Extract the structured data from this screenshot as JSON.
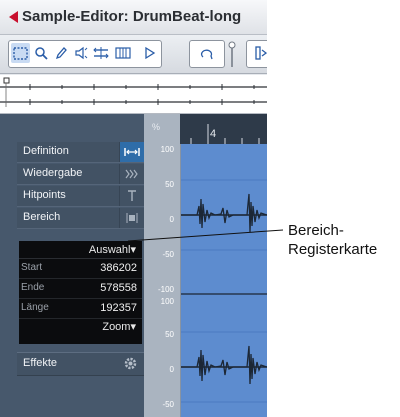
{
  "window": {
    "title": "Sample-Editor: DrumBeat-long"
  },
  "toolbar": {
    "tools": [
      {
        "name": "range-selection-icon",
        "active": true
      },
      {
        "name": "zoom-icon"
      },
      {
        "name": "pencil-icon"
      },
      {
        "name": "audition-icon"
      },
      {
        "name": "scrub-icon"
      },
      {
        "name": "snap-grid-icon"
      },
      {
        "name": "play-icon"
      },
      {
        "name": "loop-icon"
      }
    ]
  },
  "inspector": {
    "sections": [
      {
        "label": "Definition",
        "icon": "definition-icon",
        "active": true
      },
      {
        "label": "Wiedergabe",
        "icon": "playback-icon"
      },
      {
        "label": "Hitpoints",
        "icon": "hitpoints-icon"
      },
      {
        "label": "Bereich",
        "icon": "range-icon"
      }
    ],
    "range_panel": {
      "selection_menu": "Auswahl",
      "rows": [
        {
          "key": "Start",
          "value": "386202"
        },
        {
          "key": "Ende",
          "value": "578558"
        },
        {
          "key": "Länge",
          "value": "192357"
        }
      ],
      "zoom_menu": "Zoom"
    },
    "effects": {
      "label": "Effekte",
      "icon": "gear-icon"
    }
  },
  "ruler": {
    "position_label": "4",
    "unit_label": "%"
  },
  "scale": {
    "labels_top": [
      "100",
      "50",
      "0",
      "-50",
      "-100"
    ],
    "labels_bottom": [
      "100",
      "50",
      "0",
      "-50"
    ]
  },
  "callout": {
    "line1": "Bereich-",
    "line2": "Registerkarte"
  },
  "colors": {
    "accent": "#2f6da9",
    "waveform_bg": "#5d8ccf",
    "inspector_bg": "#47586c",
    "title_arrow": "#c8102e"
  }
}
